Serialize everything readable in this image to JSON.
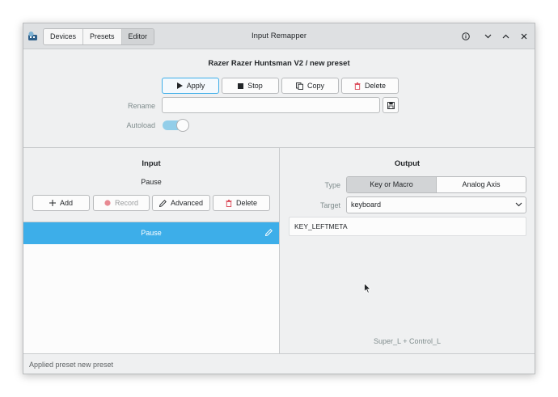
{
  "window": {
    "title": "Input Remapper",
    "tabs": [
      "Devices",
      "Presets",
      "Editor"
    ],
    "active_tab": "Editor"
  },
  "preset": {
    "heading": "Razer Razer Huntsman V2  /  new preset",
    "actions": {
      "apply": "Apply",
      "stop": "Stop",
      "copy": "Copy",
      "delete": "Delete"
    },
    "rename_label": "Rename",
    "rename_value": "",
    "autoload_label": "Autoload",
    "autoload_on": true
  },
  "input_panel": {
    "heading": "Input",
    "current_input": "Pause",
    "buttons": {
      "add": "Add",
      "record": "Record",
      "advanced": "Advanced",
      "delete": "Delete"
    },
    "mappings": [
      {
        "label": "Pause",
        "selected": true
      }
    ]
  },
  "output_panel": {
    "heading": "Output",
    "type_label": "Type",
    "type_options": [
      "Key or Macro",
      "Analog Axis"
    ],
    "type_selected": "Key or Macro",
    "target_label": "Target",
    "target_value": "keyboard",
    "editor_text": "KEY_LEFTMETA",
    "combination_hint": "Super_L + Control_L"
  },
  "status": {
    "message": "Applied preset new preset"
  },
  "colors": {
    "accent": "#3daee9",
    "window_bg": "#eff0f1",
    "delete_icon": "#da4453"
  }
}
